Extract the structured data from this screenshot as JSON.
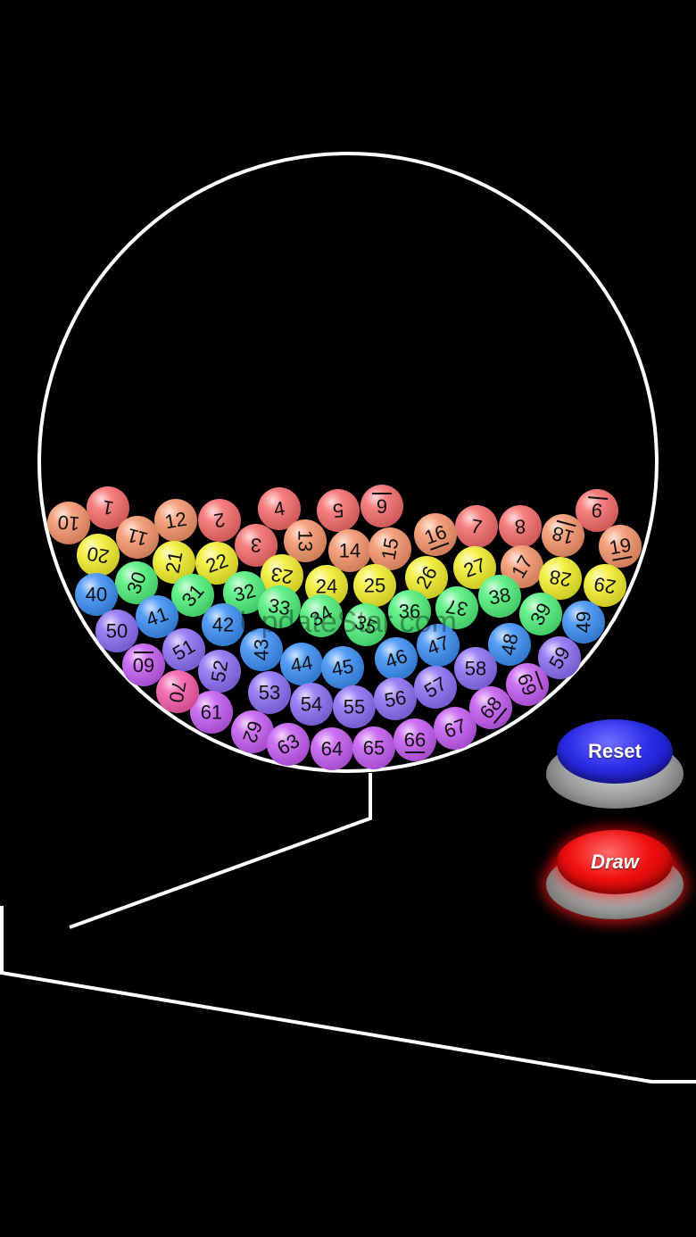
{
  "machine": {
    "balls": [
      {
        "n": "1",
        "color": "#f56a6a"
      },
      {
        "n": "2",
        "color": "#f56a6a"
      },
      {
        "n": "3",
        "color": "#f56a6a"
      },
      {
        "n": "4",
        "color": "#f56a6a"
      },
      {
        "n": "5",
        "color": "#f56a6a"
      },
      {
        "n": "6",
        "color": "#f56a6a"
      },
      {
        "n": "7",
        "color": "#f56a6a"
      },
      {
        "n": "8",
        "color": "#f56a6a"
      },
      {
        "n": "9",
        "color": "#f56a6a"
      },
      {
        "n": "10",
        "color": "#f5946a"
      },
      {
        "n": "11",
        "color": "#f5946a"
      },
      {
        "n": "12",
        "color": "#f5946a"
      },
      {
        "n": "13",
        "color": "#f5946a"
      },
      {
        "n": "14",
        "color": "#f5946a"
      },
      {
        "n": "15",
        "color": "#f5946a"
      },
      {
        "n": "16",
        "color": "#f5946a"
      },
      {
        "n": "17",
        "color": "#f5946a"
      },
      {
        "n": "18",
        "color": "#f5946a"
      },
      {
        "n": "19",
        "color": "#f5946a"
      },
      {
        "n": "20",
        "color": "#f2ef2a"
      },
      {
        "n": "21",
        "color": "#f2ef2a"
      },
      {
        "n": "22",
        "color": "#f2ef2a"
      },
      {
        "n": "23",
        "color": "#f2ef2a"
      },
      {
        "n": "24",
        "color": "#f2ef2a"
      },
      {
        "n": "25",
        "color": "#f2ef2a"
      },
      {
        "n": "26",
        "color": "#f2ef2a"
      },
      {
        "n": "27",
        "color": "#f2ef2a"
      },
      {
        "n": "28",
        "color": "#f2ef2a"
      },
      {
        "n": "29",
        "color": "#f2ef2a"
      },
      {
        "n": "30",
        "color": "#4ef07a"
      },
      {
        "n": "31",
        "color": "#4ef07a"
      },
      {
        "n": "32",
        "color": "#4ef07a"
      },
      {
        "n": "33",
        "color": "#4ef07a"
      },
      {
        "n": "34",
        "color": "#4ef07a"
      },
      {
        "n": "35",
        "color": "#4ef07a"
      },
      {
        "n": "36",
        "color": "#4ef07a"
      },
      {
        "n": "37",
        "color": "#4ef07a"
      },
      {
        "n": "38",
        "color": "#4ef07a"
      },
      {
        "n": "39",
        "color": "#4ef07a"
      },
      {
        "n": "40",
        "color": "#3a8ef5"
      },
      {
        "n": "41",
        "color": "#3a8ef5"
      },
      {
        "n": "42",
        "color": "#3a8ef5"
      },
      {
        "n": "43",
        "color": "#3a8ef5"
      },
      {
        "n": "44",
        "color": "#3a8ef5"
      },
      {
        "n": "45",
        "color": "#3a8ef5"
      },
      {
        "n": "46",
        "color": "#3a8ef5"
      },
      {
        "n": "47",
        "color": "#3a8ef5"
      },
      {
        "n": "48",
        "color": "#3a8ef5"
      },
      {
        "n": "49",
        "color": "#3a8ef5"
      },
      {
        "n": "50",
        "color": "#8a6ef5"
      },
      {
        "n": "51",
        "color": "#8a6ef5"
      },
      {
        "n": "52",
        "color": "#8a6ef5"
      },
      {
        "n": "53",
        "color": "#8a6ef5"
      },
      {
        "n": "54",
        "color": "#8a6ef5"
      },
      {
        "n": "55",
        "color": "#8a6ef5"
      },
      {
        "n": "56",
        "color": "#8a6ef5"
      },
      {
        "n": "57",
        "color": "#8a6ef5"
      },
      {
        "n": "58",
        "color": "#8a6ef5"
      },
      {
        "n": "59",
        "color": "#8a6ef5"
      },
      {
        "n": "60",
        "color": "#c45af2"
      },
      {
        "n": "61",
        "color": "#c45af2"
      },
      {
        "n": "62",
        "color": "#c45af2"
      },
      {
        "n": "63",
        "color": "#c45af2"
      },
      {
        "n": "64",
        "color": "#c45af2"
      },
      {
        "n": "65",
        "color": "#c45af2"
      },
      {
        "n": "66",
        "color": "#c45af2"
      },
      {
        "n": "67",
        "color": "#c45af2"
      },
      {
        "n": "68",
        "color": "#c45af2"
      },
      {
        "n": "69",
        "color": "#c45af2"
      },
      {
        "n": "70",
        "color": "#f55aa8"
      }
    ]
  },
  "buttons": {
    "reset_label": "Reset",
    "draw_label": "Draw"
  },
  "watermark": "UpdateStar.com",
  "colors": {
    "background": "#000000",
    "outline": "#ffffff",
    "reset": "#2c2ce8",
    "draw": "#f01010"
  }
}
